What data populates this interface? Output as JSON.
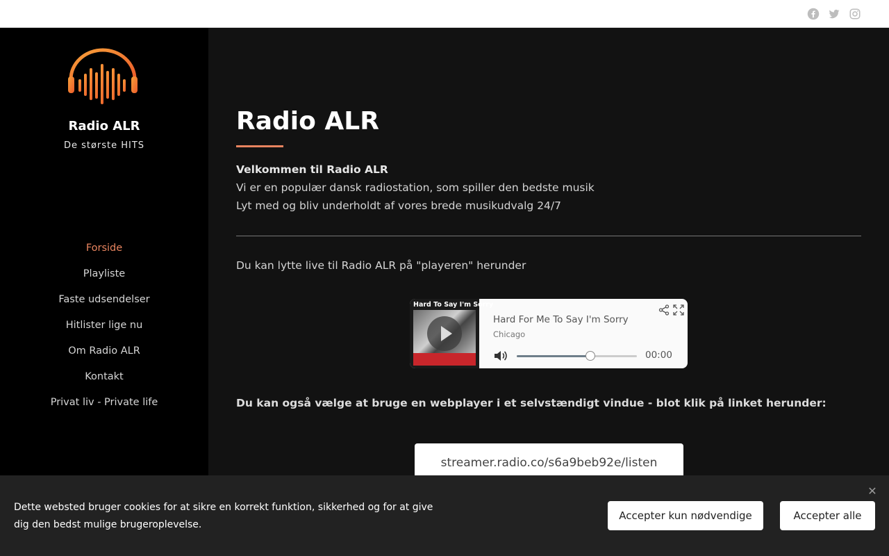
{
  "topbar": {
    "social_icons": [
      "facebook-icon",
      "twitter-icon",
      "instagram-icon"
    ]
  },
  "sidebar": {
    "logo": "headphones-logo",
    "title": "Radio ALR",
    "subtitle": "De største HITS",
    "nav": [
      {
        "label": "Forside",
        "active": true
      },
      {
        "label": "Playliste"
      },
      {
        "label": "Faste udsendelser"
      },
      {
        "label": "Hitlister lige nu"
      },
      {
        "label": "Om Radio ALR"
      },
      {
        "label": "Kontakt"
      },
      {
        "label": "Privat liv - Private life"
      }
    ]
  },
  "main": {
    "heading": "Radio ALR",
    "intro_bold": "Velkommen til Radio ALR",
    "intro_line1": "Vi er en populær dansk radiostation, som spiller den bedste musik",
    "intro_line2": "Lyt med og bliv underholdt af vores brede musikudvalg 24/7",
    "listen_text": "Du kan lytte live til Radio ALR på \"playeren\" herunder",
    "webplayer_text": "Du kan også vælge at bruge en webplayer i et selvstændigt vindue - blot klik på linket herunder:",
    "stream_link": "streamer.radio.co/s6a9beb92e/listen"
  },
  "player": {
    "cover_text": "Hard To Say I'm Sorry",
    "track": "Hard For Me To Say I'm Sorry",
    "artist": "Chicago",
    "time": "00:00",
    "volume_level": 0.61
  },
  "cookie": {
    "text": "Dette websted bruger cookies for at sikre en korrekt funktion, sikkerhed og for at give dig den bedst mulige brugeroplevelse.",
    "btn_necessary": "Accepter kun nødvendige",
    "btn_all": "Accepter alle",
    "close_glyph": "✕"
  },
  "colors": {
    "accent": "#e8845f",
    "background": "#121212",
    "sidebar": "#000000"
  }
}
